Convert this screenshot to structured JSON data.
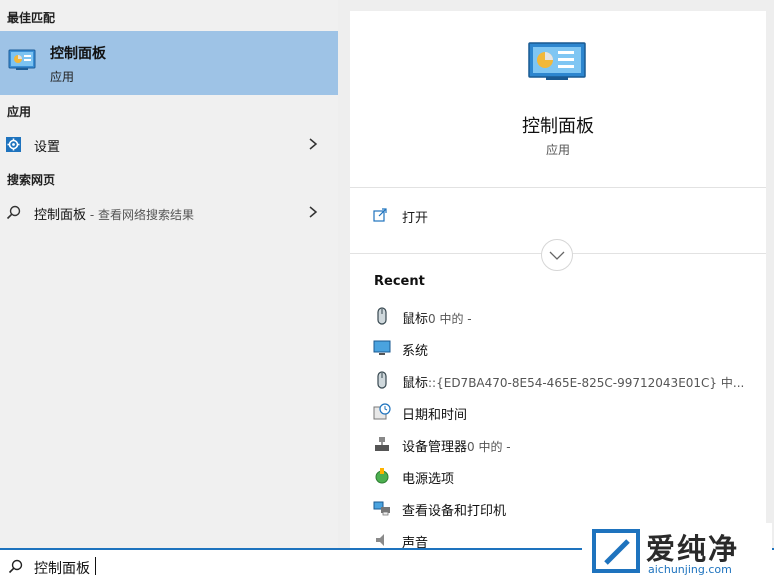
{
  "left_panel": {
    "best_match_header": "最佳匹配",
    "best_match": {
      "title": "控制面板",
      "subtitle": "应用",
      "icon": "control-panel-icon"
    },
    "apps_header": "应用",
    "apps": [
      {
        "label": "设置",
        "icon": "gear-icon"
      }
    ],
    "web_header": "搜索网页",
    "web": [
      {
        "label": "控制面板",
        "suffix": " - 查看网络搜索结果",
        "icon": "search-icon"
      }
    ]
  },
  "preview": {
    "icon": "control-panel-icon",
    "title": "控制面板",
    "subtitle": "应用",
    "open_label": "打开",
    "recent_title": "Recent",
    "recent": [
      {
        "label": "鼠标",
        "suffix": "0 中的 -",
        "icon": "mouse-icon"
      },
      {
        "label": "系统",
        "suffix": "",
        "icon": "monitor-icon"
      },
      {
        "label": "鼠标",
        "suffix": "::{ED7BA470-8E54-465E-825C-99712043E01C} 中...",
        "icon": "mouse-icon"
      },
      {
        "label": "日期和时间",
        "suffix": "",
        "icon": "clock-icon"
      },
      {
        "label": "设备管理器",
        "suffix": "0 中的 -",
        "icon": "device-manager-icon"
      },
      {
        "label": "电源选项",
        "suffix": "",
        "icon": "power-icon"
      },
      {
        "label": "查看设备和打印机",
        "suffix": "",
        "icon": "printer-icon"
      },
      {
        "label": "声音",
        "suffix": "",
        "icon": "speaker-icon"
      }
    ]
  },
  "search": {
    "value": "控制面板",
    "icon": "search-icon"
  },
  "watermark": {
    "text": "爱纯净",
    "url": "aichunjing.com"
  },
  "colors": {
    "accent": "#1e73be",
    "selected_bg": "#9ec3e6"
  }
}
